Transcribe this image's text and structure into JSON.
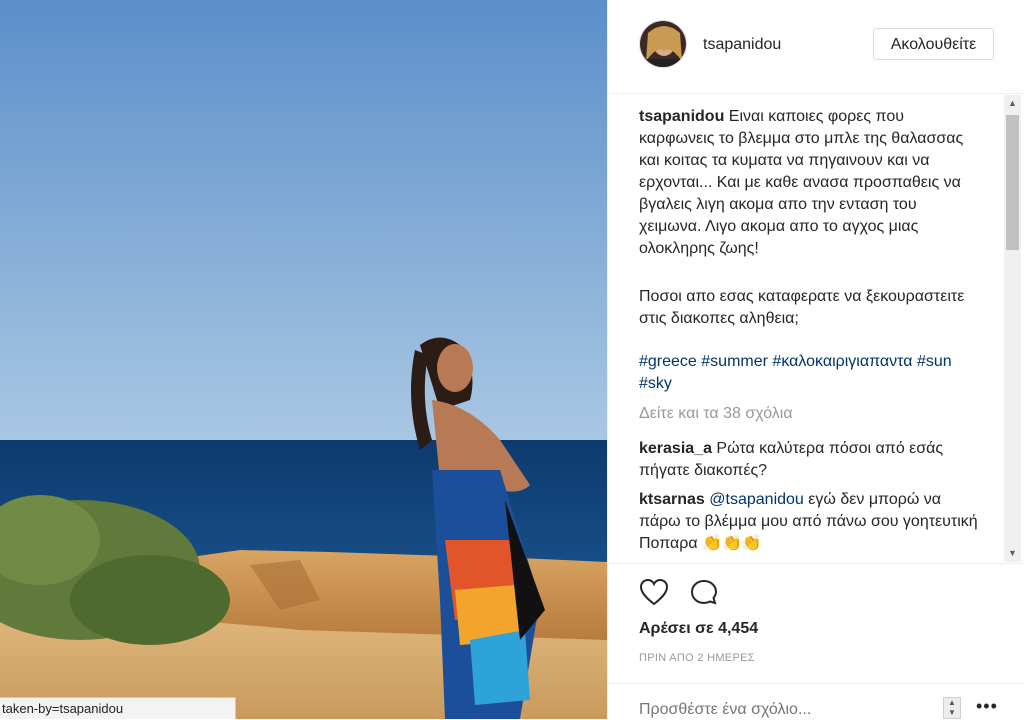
{
  "status_url": "taken-by=tsapanidou",
  "header": {
    "username": "tsapanidou",
    "follow_label": "Ακολουθείτε"
  },
  "caption": {
    "username": "tsapanidou",
    "text": "Ειναι καποιες φορες που καρφωνεις το βλεμμα στο μπλε της θαλασσας και κοιτας τα κυματα να πηγαινουν και να ερχονται... Και με καθε ανασα προσπαθεις να βγαλεις λιγη ακομα απο την ενταση του χειμωνα. Λιγο ακομα απο το αγχος μιας ολοκληρης ζωης!",
    "text2": "Ποσοι απο εσας καταφερατε να ξεκουραστειτε στις διακοπες αληθεια;",
    "hashtags": [
      "#greece",
      "#summer",
      "#καλοκαιριγιαπαντα",
      "#sun",
      "#sky"
    ]
  },
  "view_all": "Δείτε και τα 38 σχόλια",
  "comments": [
    {
      "username": "kerasia_a",
      "text": "Ρώτα καλύτερα πόσοι από εσάς πήγατε διακοπές?"
    },
    {
      "username": "ktsarnas",
      "mention": "@tsapanidou",
      "text": "εγώ δεν μπορώ να πάρω το βλέμμα μου από πάνω σου γοητευτική Ποπαρα 👏👏👏"
    }
  ],
  "likes": "Αρέσει σε 4,454",
  "timestamp": "ΠΡΙΝ ΑΠΟ 2 ΗΜΕΡΕΣ",
  "comment_input": {
    "placeholder": "Προσθέστε ένα σχόλιο..."
  },
  "more_icon": "ellipsis-icon",
  "colors": {
    "link": "#003569",
    "secondary": "#999999",
    "text": "#262626"
  }
}
